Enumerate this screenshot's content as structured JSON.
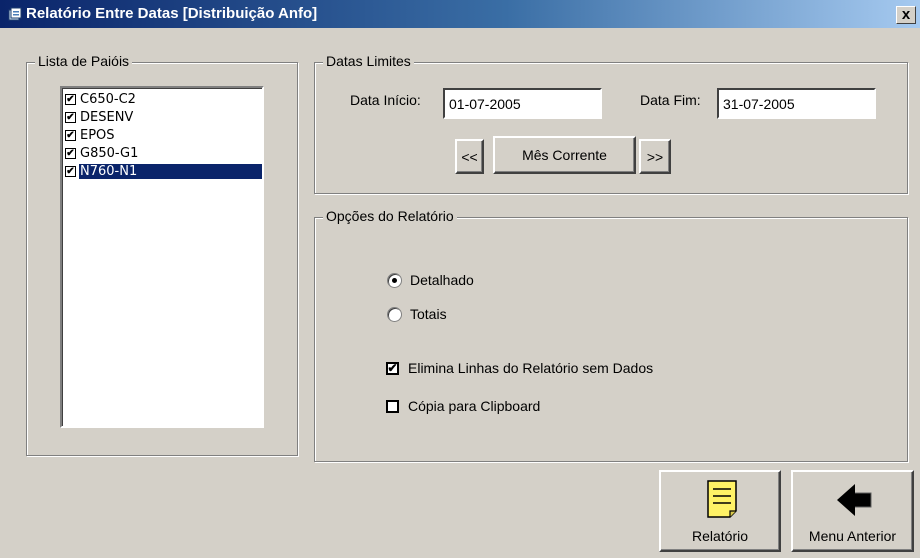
{
  "window": {
    "title": "Relatório Entre Datas [Distribuição Anfo]",
    "close_label": "x"
  },
  "paiois": {
    "legend": "Lista de Paióis",
    "items": [
      {
        "label": "C650-C2",
        "checked": true
      },
      {
        "label": "DESENV",
        "checked": true
      },
      {
        "label": "EPOS",
        "checked": true
      },
      {
        "label": "G850-G1",
        "checked": true
      },
      {
        "label": "N760-N1",
        "checked": true,
        "selected": true
      }
    ]
  },
  "datas": {
    "legend": "Datas Limites",
    "inicio_label": "Data Início:",
    "inicio_value": "01-07-2005",
    "fim_label": "Data Fim:",
    "fim_value": "31-07-2005",
    "prev_label": "<<",
    "current_label": "Mês Corrente",
    "next_label": ">>"
  },
  "opcoes": {
    "legend": "Opções do Relatório",
    "radio_detalhado": "Detalhado",
    "radio_totais": "Totais",
    "selected_radio": "Detalhado",
    "check_elimina": "Elimina Linhas do Relatório sem Dados",
    "check_elimina_checked": true,
    "check_copia": "Cópia para Clipboard",
    "check_copia_checked": false
  },
  "buttons": {
    "relatorio": "Relatório",
    "menu_anterior": "Menu Anterior"
  },
  "icons": {
    "title": "app-icon",
    "relatorio": "document-icon",
    "menu_anterior": "back-arrow-icon"
  },
  "colors": {
    "title_bar_start": "#0a246a",
    "selection": "#0a246a",
    "face": "#d4d0c8",
    "note_yellow": "#fff266"
  }
}
